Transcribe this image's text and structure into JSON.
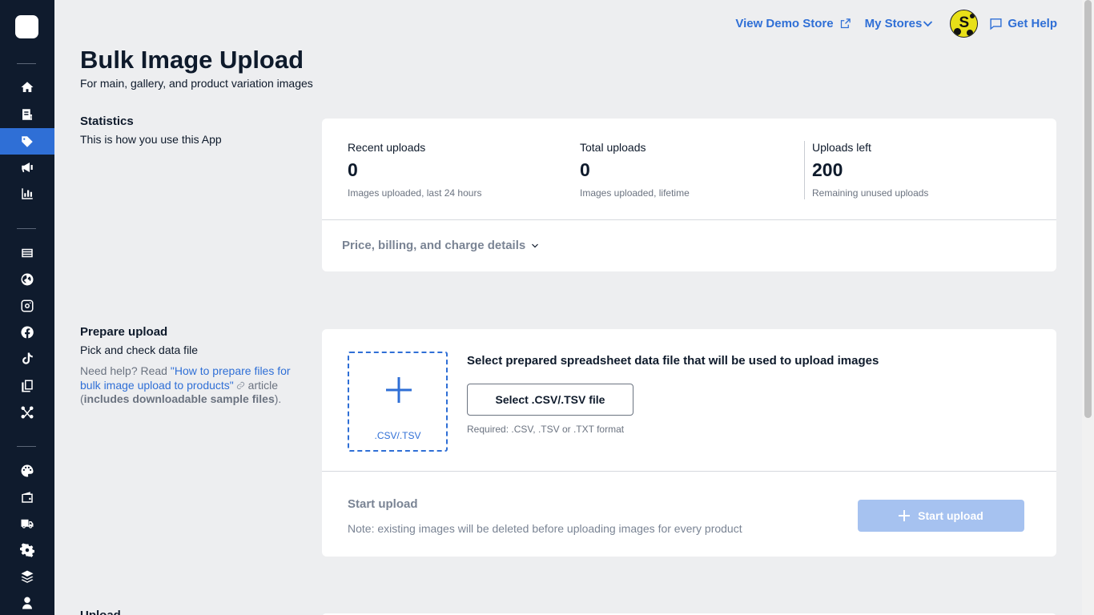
{
  "header": {
    "view_demo_store": "View Demo Store",
    "my_stores": "My Stores",
    "avatar_letter": "S",
    "get_help": "Get Help"
  },
  "sidebar": {
    "items": [
      {
        "icon": "home-icon"
      },
      {
        "icon": "orders-icon"
      },
      {
        "icon": "tag-icon",
        "active": true
      },
      {
        "icon": "megaphone-icon"
      },
      {
        "icon": "bar-chart-icon"
      },
      {
        "icon": "catalog-icon"
      },
      {
        "icon": "globe-icon"
      },
      {
        "icon": "instagram-icon"
      },
      {
        "icon": "facebook-icon"
      },
      {
        "icon": "tiktok-icon"
      },
      {
        "icon": "pages-icon"
      },
      {
        "icon": "share-icon"
      },
      {
        "icon": "palette-icon"
      },
      {
        "icon": "wallet-icon"
      },
      {
        "icon": "truck-icon"
      },
      {
        "icon": "gear-icon"
      },
      {
        "icon": "layers-icon"
      },
      {
        "icon": "user-icon"
      }
    ]
  },
  "page": {
    "title": "Bulk Image Upload",
    "subtitle": "For main, gallery, and product variation images"
  },
  "statistics": {
    "title": "Statistics",
    "description": "This is how you use this App",
    "stats": [
      {
        "label": "Recent uploads",
        "value": "0",
        "note": "Images uploaded, last 24 hours"
      },
      {
        "label": "Total uploads",
        "value": "0",
        "note": "Images uploaded, lifetime"
      },
      {
        "label": "Uploads left",
        "value": "200",
        "note": "Remaining unused uploads"
      }
    ],
    "billing_toggle": "Price, billing, and charge details"
  },
  "prepare": {
    "title": "Prepare upload",
    "description": "Pick and check data file",
    "help_prefix": "Need help? Read ",
    "help_link": "\"How to prepare files for bulk image upload to products\"",
    "help_mid": " article (",
    "help_bold": "includes downloadable sample files",
    "help_suffix": ").",
    "dropzone_label": ".CSV/.TSV",
    "heading": "Select prepared spreadsheet data file that will be used to upload images",
    "select_button": "Select .CSV/.TSV file",
    "required_note": "Required: .CSV, .TSV or .TXT format",
    "start_title": "Start upload",
    "start_note": "Note: existing images will be deleted before uploading images for every product",
    "start_button": "Start upload"
  },
  "next_section_title": "Upload",
  "colors": {
    "sidebar_bg": "#0f1b2d",
    "accent": "#2f6fd6",
    "page_bg": "#edeef0",
    "disabled_button": "#a6c2f0"
  }
}
